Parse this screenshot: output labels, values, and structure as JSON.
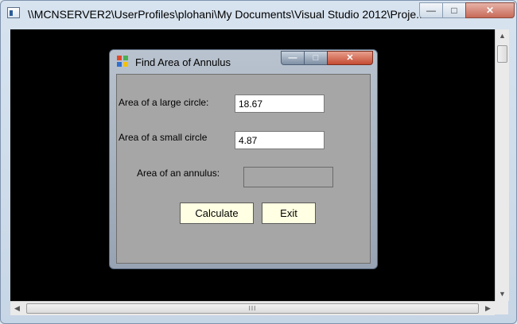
{
  "window": {
    "title": "\\\\MCNSERVER2\\UserProfiles\\plohani\\My Documents\\Visual Studio 2012\\Proje...",
    "minimize_glyph": "—",
    "maximize_glyph": "□",
    "close_glyph": "✕"
  },
  "scrollbars": {
    "up_arrow": "▲",
    "down_arrow": "▼",
    "left_arrow": "◀",
    "right_arrow": "▶",
    "thumb_grip": "III"
  },
  "dialog": {
    "title": "Find Area of Annulus",
    "minimize_glyph": "—",
    "maximize_glyph": "□",
    "close_glyph": "✕",
    "large_circle_label": "Area of a large circle:",
    "large_circle_value": "18.67",
    "small_circle_label": "Area of a small circle",
    "small_circle_value": "4.87",
    "annulus_label": "Area of an annulus:",
    "annulus_value": "",
    "calculate_label": "Calculate",
    "exit_label": "Exit"
  },
  "colors": {
    "console_background": "#000000",
    "dialog_client": "#a6a6a6",
    "button_face": "#ffffe3",
    "close_red": "#c44b32"
  },
  "icons": {
    "outer_window_icon": "console-window-icon",
    "dialog_icon": "windows-form-icon"
  }
}
